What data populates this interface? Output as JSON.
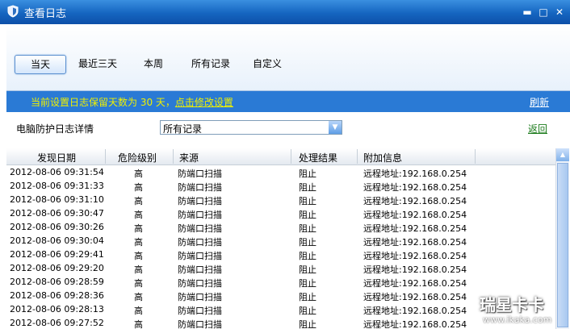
{
  "window": {
    "title": "查看日志",
    "minimize": "▬",
    "maximize": "□",
    "close": "✕"
  },
  "tabs": [
    {
      "label": "当天",
      "active": true
    },
    {
      "label": "最近三天",
      "active": false
    },
    {
      "label": "本周",
      "active": false
    },
    {
      "label": "所有记录",
      "active": false
    },
    {
      "label": "自定义",
      "active": false
    }
  ],
  "info": {
    "notice_prefix": "当前设置日志保留天数为 30 天，",
    "notice_link": "点击修改设置",
    "refresh": "刷新"
  },
  "filter": {
    "label": "电脑防护日志详情",
    "selected": "所有记录",
    "back": "返回"
  },
  "table": {
    "columns": [
      "发现日期",
      "危险级别",
      "来源",
      "处理结果",
      "附加信息"
    ],
    "rows": [
      [
        "2012-08-06 09:31:54",
        "高",
        "防端口扫描",
        "阻止",
        "远程地址:192.168.0.254"
      ],
      [
        "2012-08-06 09:31:33",
        "高",
        "防端口扫描",
        "阻止",
        "远程地址:192.168.0.254"
      ],
      [
        "2012-08-06 09:31:10",
        "高",
        "防端口扫描",
        "阻止",
        "远程地址:192.168.0.254"
      ],
      [
        "2012-08-06 09:30:47",
        "高",
        "防端口扫描",
        "阻止",
        "远程地址:192.168.0.254"
      ],
      [
        "2012-08-06 09:30:26",
        "高",
        "防端口扫描",
        "阻止",
        "远程地址:192.168.0.254"
      ],
      [
        "2012-08-06 09:30:04",
        "高",
        "防端口扫描",
        "阻止",
        "远程地址:192.168.0.254"
      ],
      [
        "2012-08-06 09:29:41",
        "高",
        "防端口扫描",
        "阻止",
        "远程地址:192.168.0.254"
      ],
      [
        "2012-08-06 09:29:20",
        "高",
        "防端口扫描",
        "阻止",
        "远程地址:192.168.0.254"
      ],
      [
        "2012-08-06 09:28:59",
        "高",
        "防端口扫描",
        "阻止",
        "远程地址:192.168.0.254"
      ],
      [
        "2012-08-06 09:28:36",
        "高",
        "防端口扫描",
        "阻止",
        "远程地址:192.168.0.254"
      ],
      [
        "2012-08-06 09:28:13",
        "高",
        "防端口扫描",
        "阻止",
        "远程地址:192.168.0.254"
      ],
      [
        "2012-08-06 09:27:52",
        "高",
        "防端口扫描",
        "阻止",
        "远程地址:192.168.0.254"
      ]
    ]
  },
  "watermark": {
    "brand": "瑞星卡卡",
    "url": "www.ikaka.com"
  },
  "icons": {
    "app": "shield-icon",
    "dropdown": "chevron-down-icon",
    "scroll_up": "arrow-up-icon"
  },
  "colors": {
    "titlebar": "#1565c0",
    "infobar": "#2a7ad5",
    "notice": "#f0f000",
    "back_link": "#1a7a1a"
  }
}
